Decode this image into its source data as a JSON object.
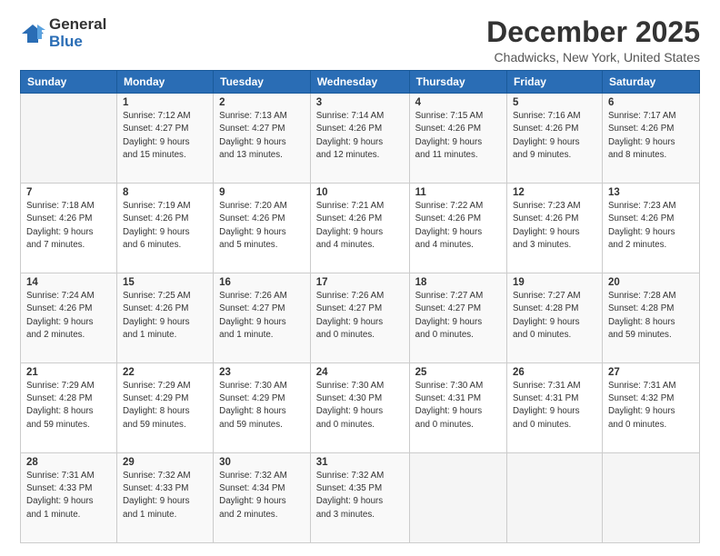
{
  "logo": {
    "general": "General",
    "blue": "Blue"
  },
  "header": {
    "month": "December 2025",
    "location": "Chadwicks, New York, United States"
  },
  "weekdays": [
    "Sunday",
    "Monday",
    "Tuesday",
    "Wednesday",
    "Thursday",
    "Friday",
    "Saturday"
  ],
  "weeks": [
    [
      {
        "day": "",
        "info": ""
      },
      {
        "day": "1",
        "info": "Sunrise: 7:12 AM\nSunset: 4:27 PM\nDaylight: 9 hours\nand 15 minutes."
      },
      {
        "day": "2",
        "info": "Sunrise: 7:13 AM\nSunset: 4:27 PM\nDaylight: 9 hours\nand 13 minutes."
      },
      {
        "day": "3",
        "info": "Sunrise: 7:14 AM\nSunset: 4:26 PM\nDaylight: 9 hours\nand 12 minutes."
      },
      {
        "day": "4",
        "info": "Sunrise: 7:15 AM\nSunset: 4:26 PM\nDaylight: 9 hours\nand 11 minutes."
      },
      {
        "day": "5",
        "info": "Sunrise: 7:16 AM\nSunset: 4:26 PM\nDaylight: 9 hours\nand 9 minutes."
      },
      {
        "day": "6",
        "info": "Sunrise: 7:17 AM\nSunset: 4:26 PM\nDaylight: 9 hours\nand 8 minutes."
      }
    ],
    [
      {
        "day": "7",
        "info": "Sunrise: 7:18 AM\nSunset: 4:26 PM\nDaylight: 9 hours\nand 7 minutes."
      },
      {
        "day": "8",
        "info": "Sunrise: 7:19 AM\nSunset: 4:26 PM\nDaylight: 9 hours\nand 6 minutes."
      },
      {
        "day": "9",
        "info": "Sunrise: 7:20 AM\nSunset: 4:26 PM\nDaylight: 9 hours\nand 5 minutes."
      },
      {
        "day": "10",
        "info": "Sunrise: 7:21 AM\nSunset: 4:26 PM\nDaylight: 9 hours\nand 4 minutes."
      },
      {
        "day": "11",
        "info": "Sunrise: 7:22 AM\nSunset: 4:26 PM\nDaylight: 9 hours\nand 4 minutes."
      },
      {
        "day": "12",
        "info": "Sunrise: 7:23 AM\nSunset: 4:26 PM\nDaylight: 9 hours\nand 3 minutes."
      },
      {
        "day": "13",
        "info": "Sunrise: 7:23 AM\nSunset: 4:26 PM\nDaylight: 9 hours\nand 2 minutes."
      }
    ],
    [
      {
        "day": "14",
        "info": "Sunrise: 7:24 AM\nSunset: 4:26 PM\nDaylight: 9 hours\nand 2 minutes."
      },
      {
        "day": "15",
        "info": "Sunrise: 7:25 AM\nSunset: 4:26 PM\nDaylight: 9 hours\nand 1 minute."
      },
      {
        "day": "16",
        "info": "Sunrise: 7:26 AM\nSunset: 4:27 PM\nDaylight: 9 hours\nand 1 minute."
      },
      {
        "day": "17",
        "info": "Sunrise: 7:26 AM\nSunset: 4:27 PM\nDaylight: 9 hours\nand 0 minutes."
      },
      {
        "day": "18",
        "info": "Sunrise: 7:27 AM\nSunset: 4:27 PM\nDaylight: 9 hours\nand 0 minutes."
      },
      {
        "day": "19",
        "info": "Sunrise: 7:27 AM\nSunset: 4:28 PM\nDaylight: 9 hours\nand 0 minutes."
      },
      {
        "day": "20",
        "info": "Sunrise: 7:28 AM\nSunset: 4:28 PM\nDaylight: 8 hours\nand 59 minutes."
      }
    ],
    [
      {
        "day": "21",
        "info": "Sunrise: 7:29 AM\nSunset: 4:28 PM\nDaylight: 8 hours\nand 59 minutes."
      },
      {
        "day": "22",
        "info": "Sunrise: 7:29 AM\nSunset: 4:29 PM\nDaylight: 8 hours\nand 59 minutes."
      },
      {
        "day": "23",
        "info": "Sunrise: 7:30 AM\nSunset: 4:29 PM\nDaylight: 8 hours\nand 59 minutes."
      },
      {
        "day": "24",
        "info": "Sunrise: 7:30 AM\nSunset: 4:30 PM\nDaylight: 9 hours\nand 0 minutes."
      },
      {
        "day": "25",
        "info": "Sunrise: 7:30 AM\nSunset: 4:31 PM\nDaylight: 9 hours\nand 0 minutes."
      },
      {
        "day": "26",
        "info": "Sunrise: 7:31 AM\nSunset: 4:31 PM\nDaylight: 9 hours\nand 0 minutes."
      },
      {
        "day": "27",
        "info": "Sunrise: 7:31 AM\nSunset: 4:32 PM\nDaylight: 9 hours\nand 0 minutes."
      }
    ],
    [
      {
        "day": "28",
        "info": "Sunrise: 7:31 AM\nSunset: 4:33 PM\nDaylight: 9 hours\nand 1 minute."
      },
      {
        "day": "29",
        "info": "Sunrise: 7:32 AM\nSunset: 4:33 PM\nDaylight: 9 hours\nand 1 minute."
      },
      {
        "day": "30",
        "info": "Sunrise: 7:32 AM\nSunset: 4:34 PM\nDaylight: 9 hours\nand 2 minutes."
      },
      {
        "day": "31",
        "info": "Sunrise: 7:32 AM\nSunset: 4:35 PM\nDaylight: 9 hours\nand 3 minutes."
      },
      {
        "day": "",
        "info": ""
      },
      {
        "day": "",
        "info": ""
      },
      {
        "day": "",
        "info": ""
      }
    ]
  ]
}
